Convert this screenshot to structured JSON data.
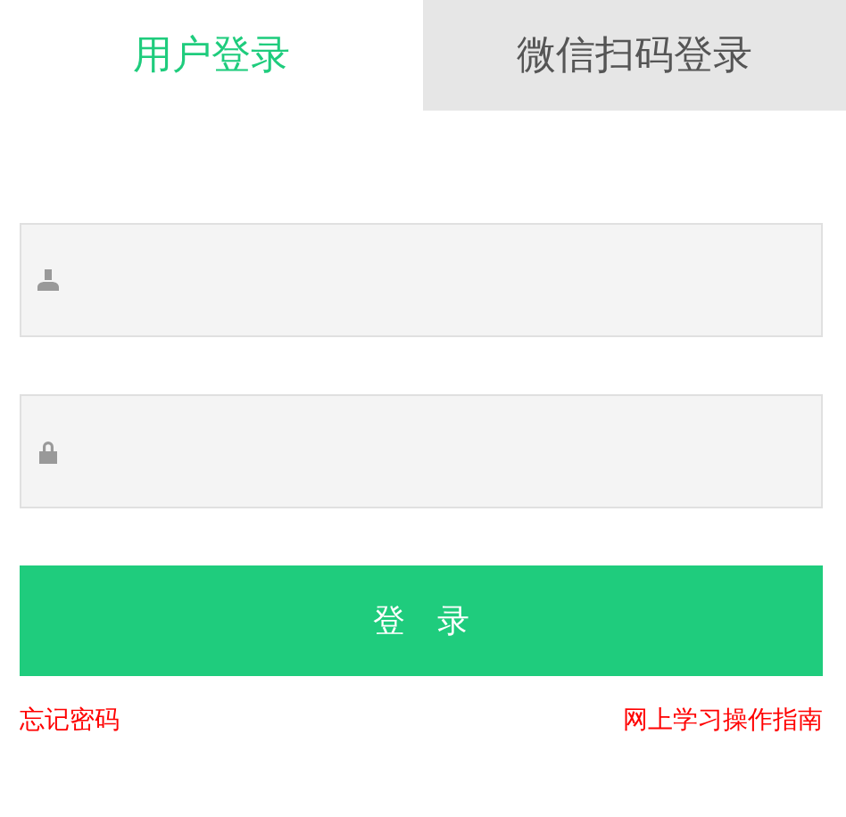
{
  "tabs": [
    {
      "label": "用户登录",
      "selected": true
    },
    {
      "label": "微信扫码登录",
      "selected": false
    }
  ],
  "fields": [
    {
      "kind": "user"
    },
    {
      "kind": "password"
    }
  ],
  "login_button": "登　录",
  "links": [
    {
      "label": "忘记密码"
    },
    {
      "label": "网上学习操作指南"
    }
  ]
}
